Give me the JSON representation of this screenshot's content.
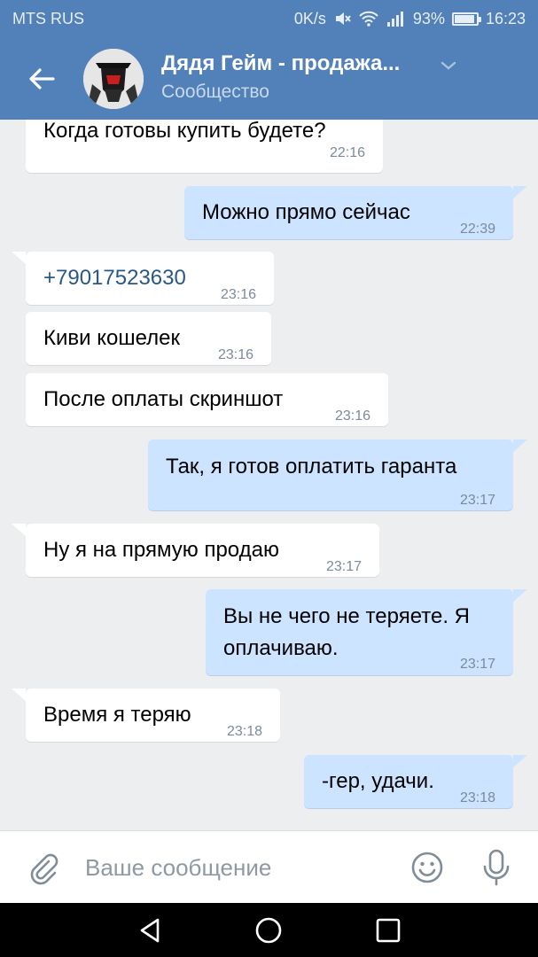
{
  "status": {
    "carrier": "MTS RUS",
    "speed": "0K/s",
    "battery": "93%",
    "battery_level": 0.93,
    "time": "16:23"
  },
  "header": {
    "title": "Дядя Гейм - продажа...",
    "subtitle": "Сообщество",
    "back_icon": "back-arrow-icon",
    "chevron_icon": "chevron-down-icon"
  },
  "messages": [
    {
      "dir": "in",
      "text": "Когда готовы купить будете?",
      "time": "22:16"
    },
    {
      "dir": "out",
      "text": "Можно прямо сейчас",
      "time": "22:39"
    },
    {
      "dir": "in",
      "text": "+79017523630",
      "time": "23:16",
      "link": true
    },
    {
      "dir": "in",
      "text": "Киви кошелек",
      "time": "23:16"
    },
    {
      "dir": "in",
      "text": "После оплаты скриншот",
      "time": "23:16"
    },
    {
      "dir": "out",
      "text": "Так, я готов оплатить гаранта",
      "time": "23:17"
    },
    {
      "dir": "in",
      "text": "Ну я на прямую продаю",
      "time": "23:17"
    },
    {
      "dir": "out",
      "text_line1": "Вы не чего не теряете. Я",
      "text_line2": "оплачиваю.",
      "time": "23:17"
    },
    {
      "dir": "in",
      "text": "Время я теряю",
      "time": "23:18"
    },
    {
      "dir": "out",
      "text": "-гер, удачи.",
      "time": "23:18"
    }
  ],
  "composer": {
    "placeholder": "Ваше сообщение",
    "attach_icon": "paperclip-icon",
    "emoji_icon": "smile-icon",
    "mic_icon": "microphone-icon"
  },
  "navbar": {
    "back_icon": "nav-back-icon",
    "home_icon": "nav-home-icon",
    "recents_icon": "nav-recents-icon"
  },
  "colors": {
    "header": "#5181b8",
    "incoming": "#ffffff",
    "outgoing": "#cce4ff",
    "background": "#edeef0"
  }
}
